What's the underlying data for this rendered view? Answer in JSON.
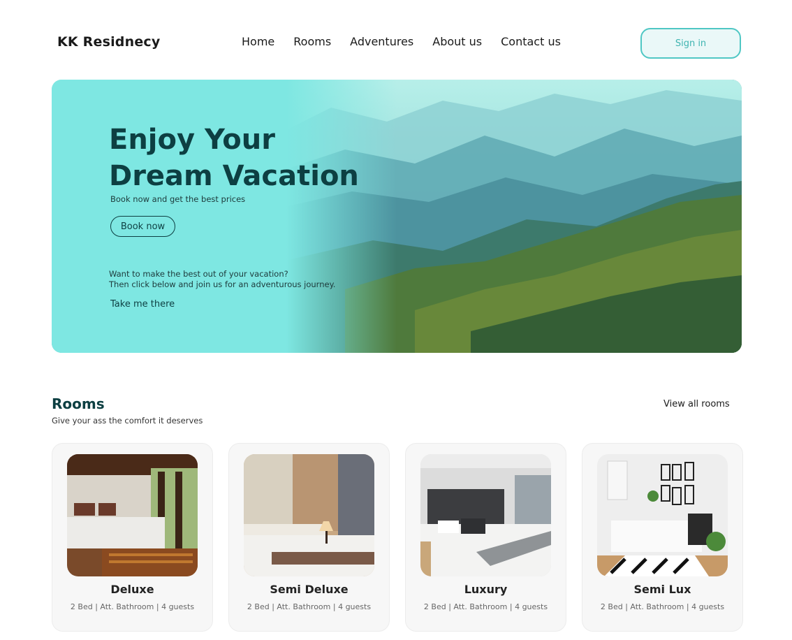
{
  "header": {
    "brand": "KK Residnecy",
    "nav": [
      "Home",
      "Rooms",
      "Adventures",
      "About us",
      "Contact us"
    ],
    "signin_label": "Sign in"
  },
  "hero": {
    "title_line1": "Enjoy Your",
    "title_line2": "Dream Vacation",
    "subtitle": "Book now and get the best prices",
    "book_label": "Book now",
    "prompt_line1": "Want to make the best out of your vacation?",
    "prompt_line2": "Then click below and join us for an adventurous journey.",
    "cta_label": "Take me there"
  },
  "rooms": {
    "heading": "Rooms",
    "tagline": "Give your ass the comfort it deserves",
    "view_all_label": "View all rooms",
    "cards": [
      {
        "name": "Deluxe",
        "details": "2 Bed | Att. Bathroom | 4 guests"
      },
      {
        "name": "Semi Deluxe",
        "details": "2 Bed | Att. Bathroom | 4 guests"
      },
      {
        "name": "Luxury",
        "details": "2 Bed | Att. Bathroom | 4 guests"
      },
      {
        "name": "Semi Lux",
        "details": "2 Bed | Att. Bathroom | 4 guests"
      }
    ]
  },
  "colors": {
    "accent": "#4fc7c4",
    "heading": "#0d3f42",
    "hero_bg": "#7ee7e2"
  }
}
